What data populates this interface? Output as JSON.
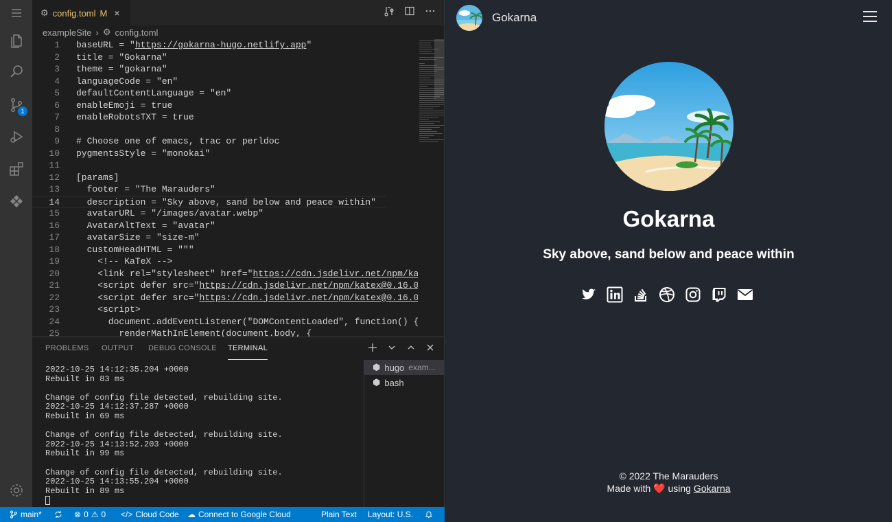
{
  "editor": {
    "tab": {
      "label": "config.toml",
      "modified": "M",
      "close": "×"
    },
    "breadcrumb": {
      "folder": "exampleSite",
      "separator": "›",
      "file": "config.toml"
    },
    "lines": [
      {
        "n": "1",
        "text": "baseURL = \"https://gokarna-hugo.netlify.app\""
      },
      {
        "n": "2",
        "text": "title = \"Gokarna\""
      },
      {
        "n": "3",
        "text": "theme = \"gokarna\""
      },
      {
        "n": "4",
        "text": "languageCode = \"en\""
      },
      {
        "n": "5",
        "text": "defaultContentLanguage = \"en\""
      },
      {
        "n": "6",
        "text": "enableEmoji = true"
      },
      {
        "n": "7",
        "text": "enableRobotsTXT = true"
      },
      {
        "n": "8",
        "text": ""
      },
      {
        "n": "9",
        "text": "# Choose one of emacs, trac or perldoc"
      },
      {
        "n": "10",
        "text": "pygmentsStyle = \"monokai\""
      },
      {
        "n": "11",
        "text": ""
      },
      {
        "n": "12",
        "text": "[params]"
      },
      {
        "n": "13",
        "text": "  footer = \"The Marauders\""
      },
      {
        "n": "14",
        "text": "  description = \"Sky above, sand below and peace within\""
      },
      {
        "n": "15",
        "text": "  avatarURL = \"/images/avatar.webp\""
      },
      {
        "n": "16",
        "text": "  AvatarAltText = \"avatar\""
      },
      {
        "n": "17",
        "text": "  avatarSize = \"size-m\""
      },
      {
        "n": "18",
        "text": "  customHeadHTML = \"\"\""
      },
      {
        "n": "19",
        "text": "    <!-- KaTeX -->"
      },
      {
        "n": "20",
        "text": "    <link rel=\"stylesheet\" href=\"https://cdn.jsdelivr.net/npm/ka"
      },
      {
        "n": "21",
        "text": "    <script defer src=\"https://cdn.jsdelivr.net/npm/katex@0.16.0"
      },
      {
        "n": "22",
        "text": "    <script defer src=\"https://cdn.jsdelivr.net/npm/katex@0.16.0"
      },
      {
        "n": "23",
        "text": "    <script>"
      },
      {
        "n": "24",
        "text": "      document.addEventListener(\"DOMContentLoaded\", function() {"
      },
      {
        "n": "25",
        "text": "        renderMathInElement(document.body, {"
      }
    ],
    "current_line": "14"
  },
  "panel": {
    "tabs": [
      "PROBLEMS",
      "OUTPUT",
      "DEBUG CONSOLE",
      "TERMINAL"
    ],
    "active_tab": "TERMINAL",
    "terminal_lines": [
      "2022-10-25 14:12:35.204 +0000",
      "Rebuilt in 83 ms",
      "",
      "Change of config file detected, rebuilding site.",
      "2022-10-25 14:12:37.287 +0000",
      "Rebuilt in 69 ms",
      "",
      "Change of config file detected, rebuilding site.",
      "2022-10-25 14:13:52.203 +0000",
      "Rebuilt in 99 ms",
      "",
      "Change of config file detected, rebuilding site.",
      "2022-10-25 14:13:55.204 +0000",
      "Rebuilt in 89 ms"
    ],
    "terminals": [
      {
        "name": "hugo",
        "detail": "exam..."
      },
      {
        "name": "bash",
        "detail": ""
      }
    ]
  },
  "activity": {
    "scm_badge": "1"
  },
  "statusbar": {
    "branch": "main*",
    "errors": "0",
    "warnings": "0",
    "cloud_code": "Cloud Code",
    "connect": "Connect to Google Cloud",
    "language": "Plain Text",
    "layout": "Layout: U.S."
  },
  "site": {
    "name": "Gokarna",
    "title": "Gokarna",
    "description": "Sky above, sand below and peace within",
    "socials": [
      "twitter-icon",
      "linkedin-icon",
      "stackoverflow-icon",
      "dribbble-icon",
      "instagram-icon",
      "twitch-icon",
      "mail-icon"
    ],
    "footer_line1": "© 2022 The Marauders",
    "footer_made": "Made with",
    "footer_heart": "❤️",
    "footer_using": "using",
    "footer_link": "Gokarna"
  },
  "colors": {
    "statusbar": "#007acc",
    "site_bg": "#23272f",
    "modified_tab": "#e8c06a"
  }
}
